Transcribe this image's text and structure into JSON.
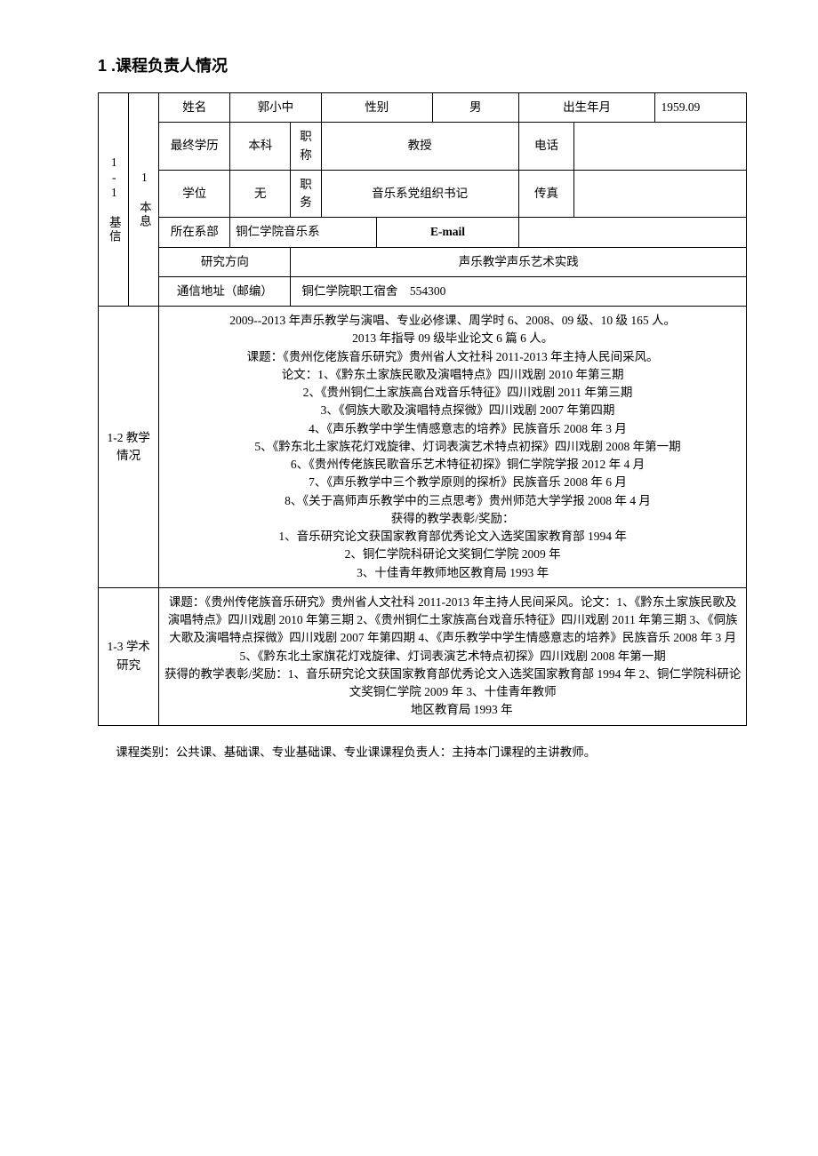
{
  "title": "1 .课程负责人情况",
  "section11_label": "1-1 基本信息",
  "info": {
    "name_label": "姓名",
    "name": "郭小中",
    "gender_label": "性别",
    "gender": "男",
    "birth_label": "出生年月",
    "birth": "1959.09",
    "edu_label": "最终学历",
    "edu": "本科",
    "title_label": "职称",
    "title_val": "教授",
    "phone_label": "电话",
    "phone": "",
    "degree_label": "学位",
    "degree": "无",
    "position_label": "职务",
    "position": "音乐系党组织书记",
    "fax_label": "传真",
    "fax": "",
    "dept_label": "所在系部",
    "dept": "铜仁学院音乐系",
    "email_label": "E-mail",
    "email": "",
    "research_label": "研究方向",
    "research": "声乐教学声乐艺术实践",
    "addr_label": "通信地址（邮编）",
    "addr": "铜仁学院职工宿舍　554300"
  },
  "section12": {
    "label": "1-2 教学情况",
    "lines": [
      "2009--2013 年声乐教学与演唱、专业必修课、周学时 6、2008、09 级、10 级 165 人。",
      "2013 年指导 09 级毕业论文 6 篇 6 人。",
      "课题：《贵州仡佬族音乐研究》贵州省人文社科 2011-2013 年主持人民间采风。",
      "论文：1、《黔东土家族民歌及演唱特点》四川戏剧 2010 年第三期",
      "2、《贵州铜仁土家族高台戏音乐特征》四川戏剧 2011 年第三期",
      "3、《侗族大歌及演唱特点探微》四川戏剧 2007 年第四期",
      "4、《声乐教学中学生情感意志的培养》民族音乐 2008 年 3 月",
      "5、《黔东北土家族花灯戏旋律、灯词表演艺术特点初探》四川戏剧 2008 年第一期",
      "6、《贵州传佬族民歌音乐艺术特征初探》铜仁学院学报 2012 年 4 月",
      "7、《声乐教学中三个教学原则的探析》民族音乐 2008 年 6 月",
      "8、《关于高师声乐教学中的三点思考》贵州师范大学学报 2008 年 4 月",
      "获得的教学表彰/奖励：",
      "1、音乐研究论文获国家教育部优秀论文入选奖国家教育部 1994 年",
      "2、铜仁学院科研论文奖铜仁学院 2009 年",
      "3、十佳青年教师地区教育局 1993 年"
    ]
  },
  "section13": {
    "label": "1-3 学术研究",
    "text_a": "课题：《贵州传佬族音乐研究》贵州省人文社科 2011-2013 年主持人民间采风。论文：1、《黔东土家族民歌及演唱特点》四川戏剧 2010 年第三期 2、《贵州铜仁土家族高台戏音乐特征》四川戏剧 2011 年第三期 3、《侗族大歌及演唱特点探微》四川戏剧 2007 年第四期 4、《声乐教学中学生情感意志的培养》民族音乐 2008 年 3 月 5、《黔东北土家旗花灯戏旋律、灯词表演艺术特点初探》四川戏剧 2008 年第一期",
    "text_b": "获得的教学表彰/奖励：1、音乐研究论文获国家教育部优秀论文入选奖国家教育部 1994 年 2、铜仁学院科研论文奖铜仁学院 2009 年 3、十佳青年教师",
    "text_c": "地区教育局 1993 年"
  },
  "footnote": "课程类别：公共课、基础课、专业基础课、专业课课程负责人：主持本门课程的主讲教师。"
}
